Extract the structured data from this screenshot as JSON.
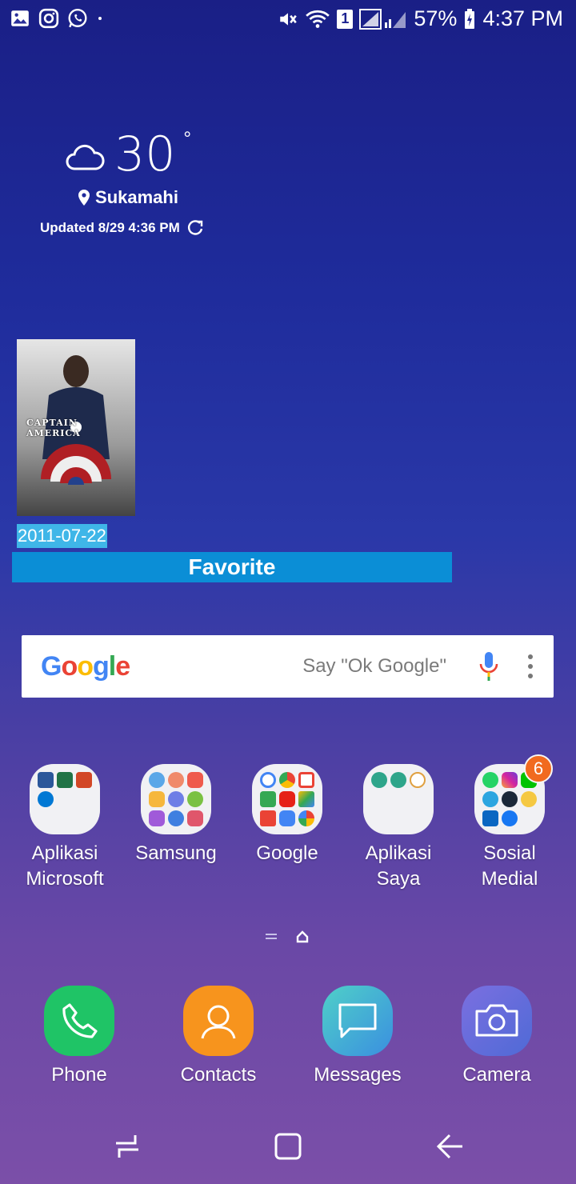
{
  "status_bar": {
    "battery": "57%",
    "time": "4:37 PM",
    "sim_slot": "1",
    "left_icons": [
      "gallery-icon",
      "instagram-icon",
      "whatsapp-icon",
      "dot-icon"
    ],
    "right_icons": [
      "mute-icon",
      "wifi-icon",
      "sim-icon",
      "signal-icon",
      "battery-icon"
    ]
  },
  "weather": {
    "temperature": "30",
    "degree_symbol": "°",
    "location": "Sukamahi",
    "updated": "Updated 8/29 4:36 PM"
  },
  "movie_widget": {
    "poster_title": "CAPTAIN AMERICA",
    "date": "2011-07-22",
    "favorite_label": "Favorite"
  },
  "google_search": {
    "logo": "Google",
    "hint": "Say \"Ok Google\""
  },
  "folders": [
    {
      "label_line1": "Aplikasi",
      "label_line2": "Microsoft",
      "badge": ""
    },
    {
      "label_line1": "Samsung",
      "label_line2": "",
      "badge": ""
    },
    {
      "label_line1": "Google",
      "label_line2": "",
      "badge": ""
    },
    {
      "label_line1": "Aplikasi",
      "label_line2": "Saya",
      "badge": ""
    },
    {
      "label_line1": "Sosial",
      "label_line2": "Medial",
      "badge": "6"
    }
  ],
  "dock": [
    {
      "label": "Phone",
      "color": "#1fc466"
    },
    {
      "label": "Contacts",
      "color": "#f7941d"
    },
    {
      "label": "Messages",
      "color": "#3cb4e0"
    },
    {
      "label": "Camera",
      "color": "#5f6fd8"
    }
  ],
  "colors": {
    "favorite_bar": "#0b8ed6",
    "date_highlight": "#3fb6e8",
    "badge": "#f16a1f"
  }
}
